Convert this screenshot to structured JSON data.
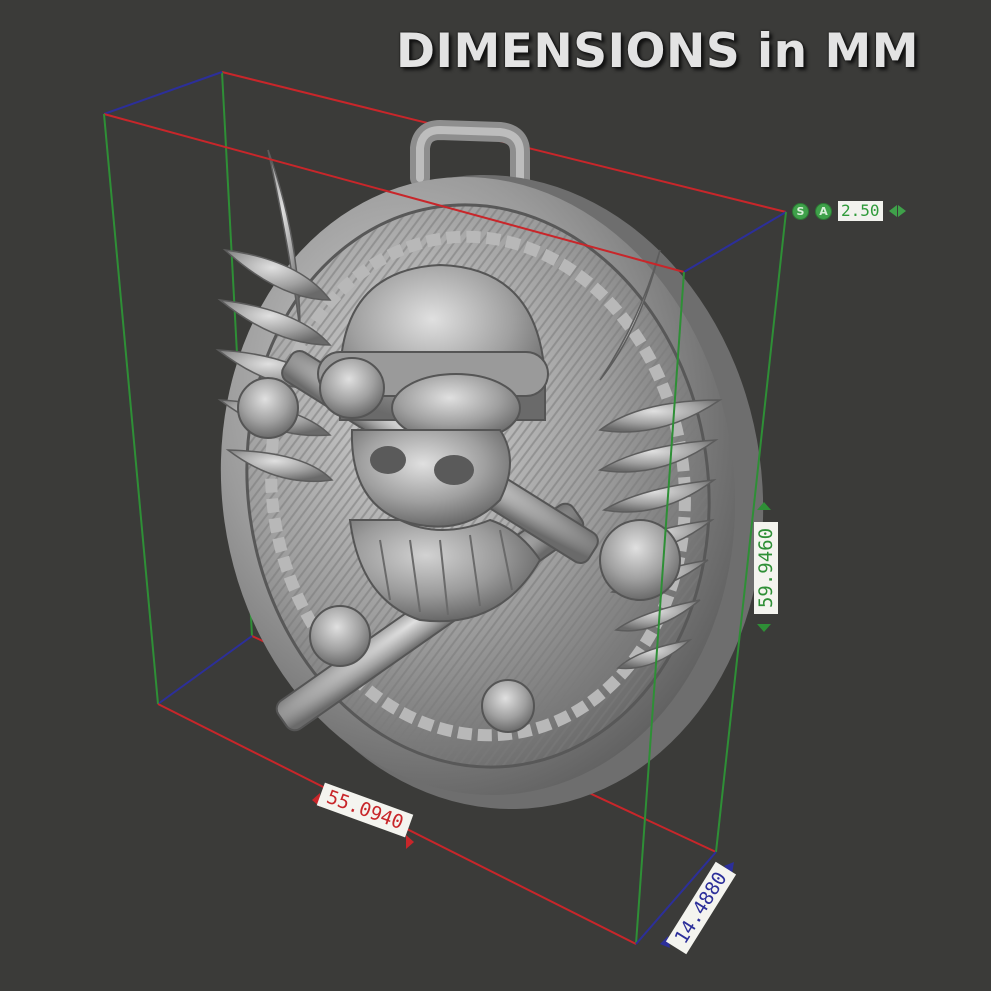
{
  "title": "DIMENSIONS in MM",
  "snap_toolbar": {
    "snap_label": "S",
    "angle_label": "A",
    "value": "2.50"
  },
  "dimensions": {
    "width": "55.0940",
    "height": "59.9460",
    "depth": "14.4880"
  },
  "colors": {
    "background": "#3b3b39",
    "x_axis": "#c8262a",
    "y_axis": "#2e8f36",
    "z_axis": "#2c2f9a",
    "model": "#a8a8a8"
  }
}
